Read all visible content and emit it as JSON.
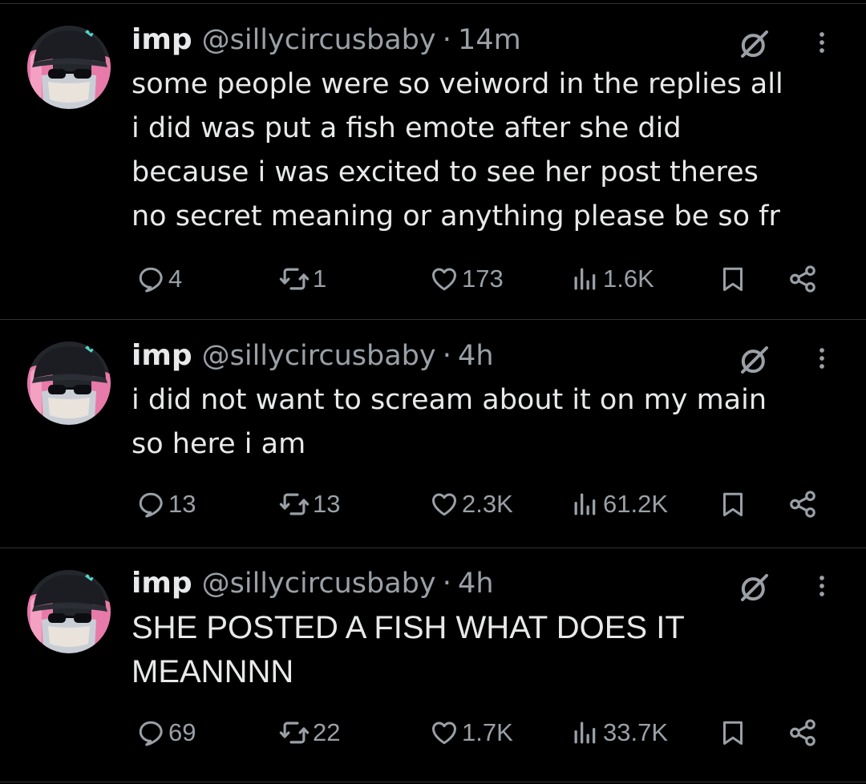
{
  "colors": {
    "background": "#000000",
    "text_primary": "#e7e9ea",
    "text_secondary": "#9aa0a6",
    "divider": "#2f3336"
  },
  "icons": {
    "reply": "reply-icon",
    "repost": "repost-icon",
    "like": "heart-icon",
    "views": "views-chart-icon",
    "bookmark": "bookmark-icon",
    "share": "share-icon",
    "grok": "grok-icon",
    "more": "more-vertical-icon"
  },
  "posts": [
    {
      "author": {
        "name": "imp",
        "handle": "@sillycircusbaby"
      },
      "separator": "·",
      "time": "14m",
      "text": "some people were so veiword in the replies all\ni did was put a fish emote after she did\nbecause i was excited to see her post theres\nno secret meaning or anything please be so fr",
      "stats": {
        "replies": "4",
        "reposts": "1",
        "likes": "173",
        "views": "1.6K"
      }
    },
    {
      "author": {
        "name": "imp",
        "handle": "@sillycircusbaby"
      },
      "separator": "·",
      "time": "4h",
      "text": "i did not want to scream about it on my main\nso here i am",
      "stats": {
        "replies": "13",
        "reposts": "13",
        "likes": "2.3K",
        "views": "61.2K"
      }
    },
    {
      "author": {
        "name": "imp",
        "handle": "@sillycircusbaby"
      },
      "separator": "·",
      "time": "4h",
      "text": "SHE POSTED A FISH WHAT DOES IT\nMEANNNN",
      "stats": {
        "replies": "69",
        "reposts": "22",
        "likes": "1.7K",
        "views": "33.7K"
      }
    }
  ]
}
